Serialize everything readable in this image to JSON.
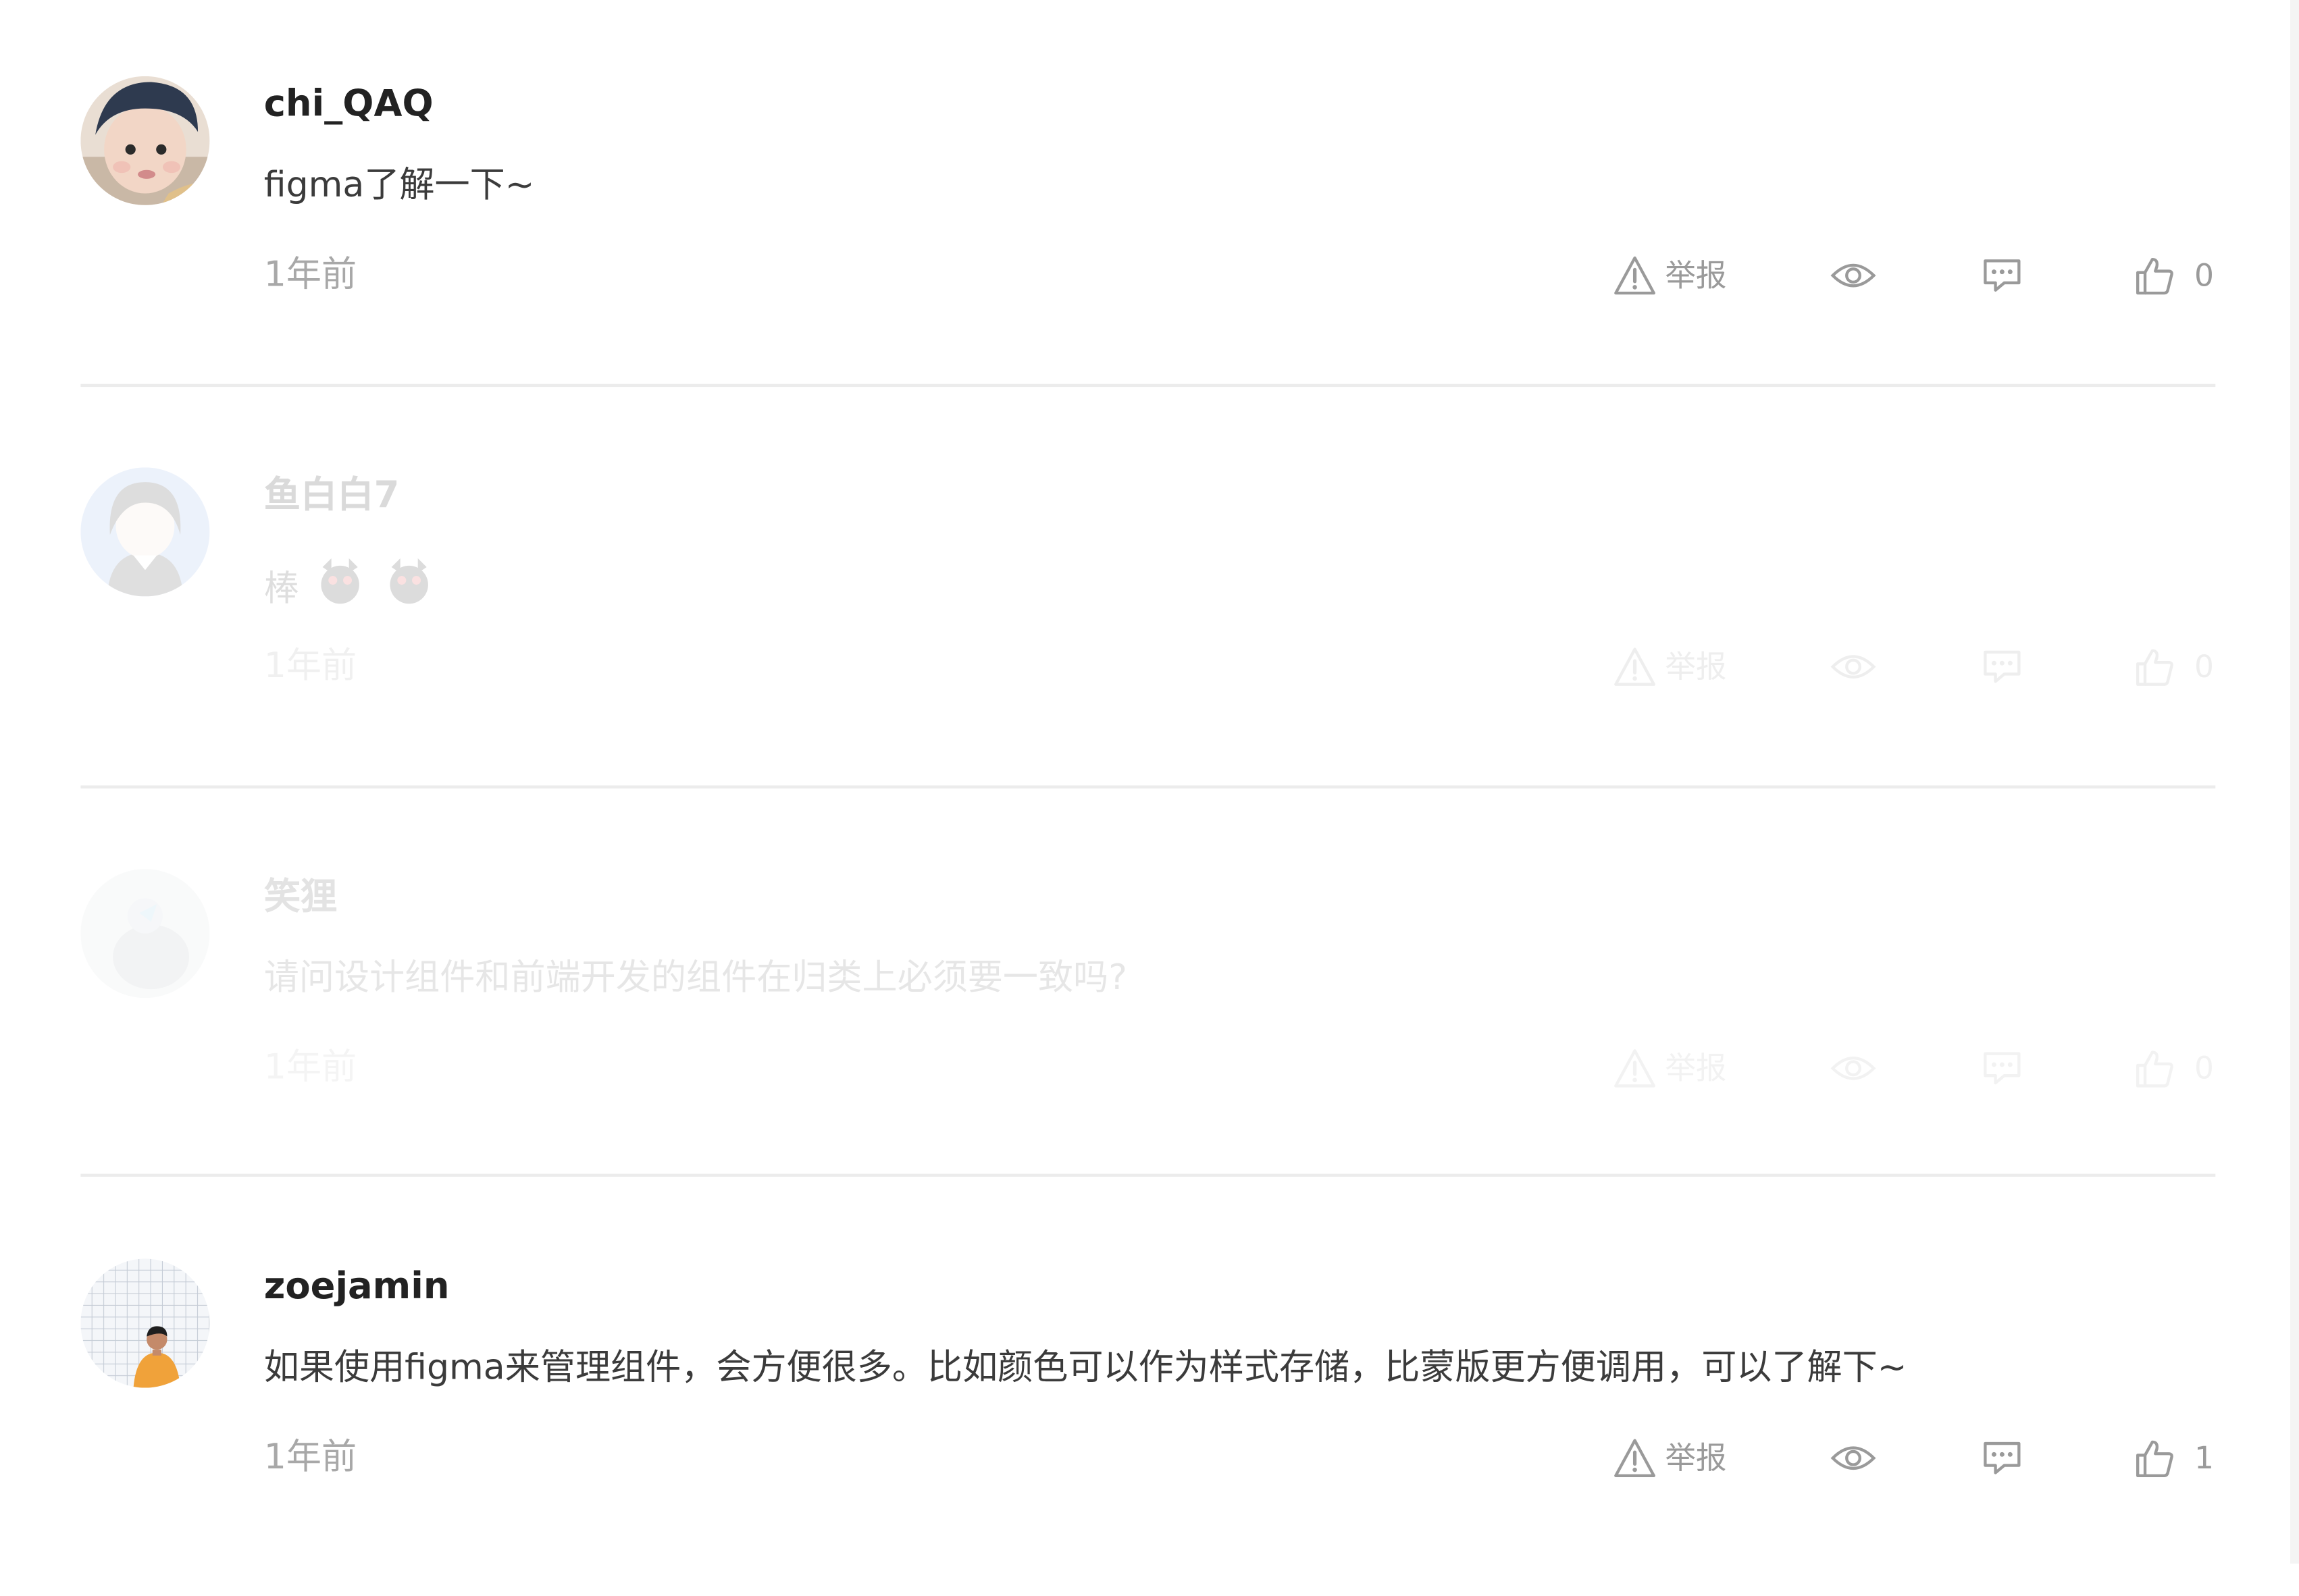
{
  "actions": {
    "report_label": "举报"
  },
  "comments": [
    {
      "username": "chi_QAQ",
      "content": "figma了解一下~",
      "time": "1年前",
      "likes": "0",
      "avatar_icon": "avatar-child-photo",
      "faded": false
    },
    {
      "username": "鱼白白7",
      "content": "棒",
      "emoji_icon": "devil-emoji-icon",
      "time": "1年前",
      "likes": "0",
      "avatar_icon": "avatar-illustration-girl",
      "faded": true
    },
    {
      "username": "笑狸",
      "content": "请问设计组件和前端开发的组件在归类上必须要一致吗?",
      "time": "1年前",
      "likes": "0",
      "avatar_icon": "avatar-gray-photo",
      "faded": true
    },
    {
      "username": "zoejamin",
      "content": "如果使用figma来管理组件，会方便很多。比如颜色可以作为样式存储，比蒙版更方便调用，可以了解下~",
      "time": "1年前",
      "likes": "1",
      "avatar_icon": "avatar-person-tile-wall",
      "faded": false
    }
  ],
  "colors": {
    "username": "#222222",
    "content": "#3b3b3b",
    "meta": "#a8a8a8",
    "icon": "#9a9a9a",
    "divider": "#ececec"
  }
}
